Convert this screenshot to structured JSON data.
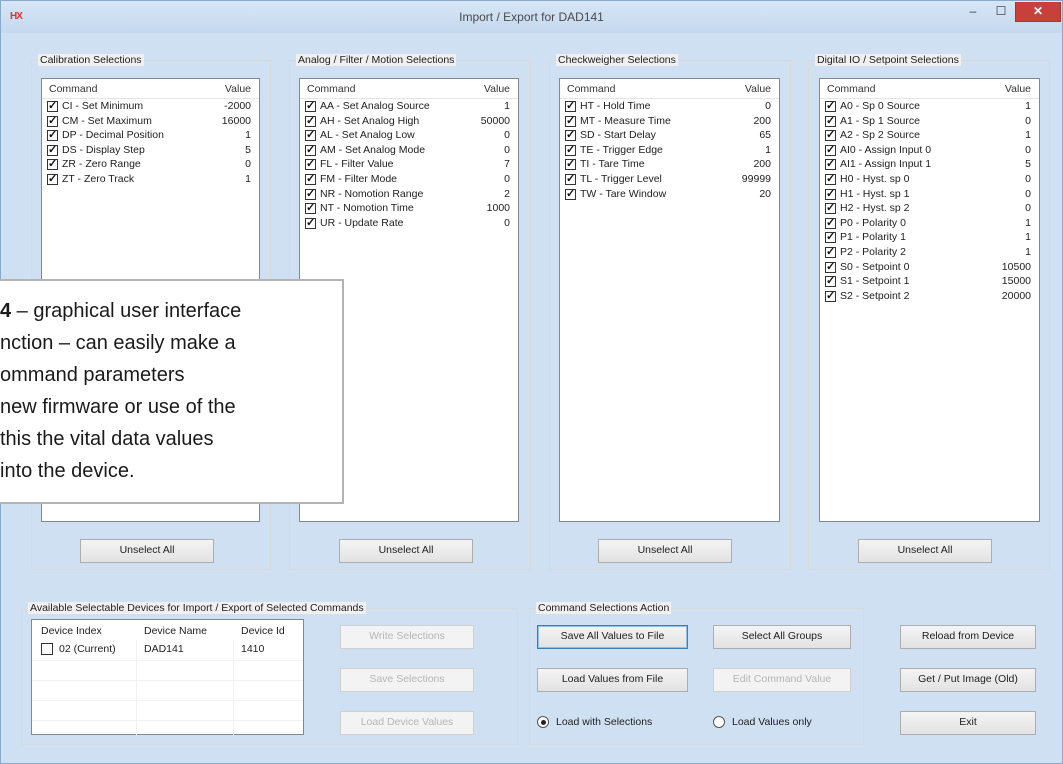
{
  "window": {
    "title": "Import / Export for DAD141",
    "app_icon_glyph": "HX",
    "minimize_glyph": "–",
    "maximize_glyph": "☐",
    "close_glyph": "✕"
  },
  "columns": {
    "command": "Command",
    "value": "Value"
  },
  "unselect_label": "Unselect All",
  "calibration": {
    "title": "Calibration Selections",
    "rows": [
      {
        "cmd": "CI - Set Minimum",
        "val": "-2000"
      },
      {
        "cmd": "CM - Set Maximum",
        "val": "16000"
      },
      {
        "cmd": "DP - Decimal Position",
        "val": "1"
      },
      {
        "cmd": "DS - Display Step",
        "val": "5"
      },
      {
        "cmd": "ZR - Zero Range",
        "val": "0"
      },
      {
        "cmd": "ZT - Zero Track",
        "val": "1"
      }
    ]
  },
  "analog": {
    "title": "Analog / Filter / Motion Selections",
    "rows": [
      {
        "cmd": "AA - Set Analog Source",
        "val": "1"
      },
      {
        "cmd": "AH - Set Analog High",
        "val": "50000"
      },
      {
        "cmd": "AL - Set Analog Low",
        "val": "0"
      },
      {
        "cmd": "AM - Set Analog Mode",
        "val": "0"
      },
      {
        "cmd": "FL - Filter Value",
        "val": "7"
      },
      {
        "cmd": "FM - Filter Mode",
        "val": "0"
      },
      {
        "cmd": "NR - Nomotion Range",
        "val": "2"
      },
      {
        "cmd": "NT - Nomotion Time",
        "val": "1000"
      },
      {
        "cmd": "UR - Update Rate",
        "val": "0"
      }
    ]
  },
  "checkweigher": {
    "title": "Checkweigher Selections",
    "rows": [
      {
        "cmd": "HT - Hold Time",
        "val": "0"
      },
      {
        "cmd": "MT - Measure Time",
        "val": "200"
      },
      {
        "cmd": "SD - Start Delay",
        "val": "65"
      },
      {
        "cmd": "TE - Trigger Edge",
        "val": "1"
      },
      {
        "cmd": "TI - Tare Time",
        "val": "200"
      },
      {
        "cmd": "TL - Trigger Level",
        "val": "99999"
      },
      {
        "cmd": "TW - Tare Window",
        "val": "20"
      }
    ]
  },
  "digital": {
    "title": "Digital IO / Setpoint Selections",
    "rows": [
      {
        "cmd": "A0 - Sp 0 Source",
        "val": "1"
      },
      {
        "cmd": "A1 - Sp 1 Source",
        "val": "0"
      },
      {
        "cmd": "A2 - Sp 2 Source",
        "val": "1"
      },
      {
        "cmd": "AI0 - Assign Input 0",
        "val": "0"
      },
      {
        "cmd": "AI1 - Assign Input 1",
        "val": "5"
      },
      {
        "cmd": "H0 - Hyst. sp 0",
        "val": "0"
      },
      {
        "cmd": "H1 - Hyst. sp 1",
        "val": "0"
      },
      {
        "cmd": "H2 - Hyst. sp 2",
        "val": "0"
      },
      {
        "cmd": "P0 - Polarity 0",
        "val": "1"
      },
      {
        "cmd": "P1 - Polarity 1",
        "val": "1"
      },
      {
        "cmd": "P2 - Polarity 2",
        "val": "1"
      },
      {
        "cmd": "S0 - Setpoint 0",
        "val": "10500"
      },
      {
        "cmd": "S1 - Setpoint 1",
        "val": "15000"
      },
      {
        "cmd": "S2 - Setpoint 2",
        "val": "20000"
      }
    ]
  },
  "devices": {
    "title": "Available Selectable Devices for Import / Export of Selected Commands",
    "col_index": "Device Index",
    "col_name": "Device Name",
    "col_id": "Device Id",
    "row": {
      "index": "02 (Current)",
      "name": "DAD141",
      "id": "1410"
    },
    "write_btn": "Write Selections",
    "save_btn": "Save Selections",
    "load_btn": "Load Device Values"
  },
  "actions": {
    "title": "Command Selections Action",
    "save_all": "Save All Values to File",
    "select_all": "Select All Groups",
    "load_file": "Load Values from File",
    "edit_value": "Edit Command Value",
    "radio_with": "Load with Selections",
    "radio_only": "Load Values only"
  },
  "right_buttons": {
    "reload": "Reload from Device",
    "image": "Get / Put Image (Old)",
    "exit": "Exit"
  },
  "overlay": {
    "line1_bold": "4",
    "line1_rest": " – graphical user interface",
    "line2": "nction – can easily make a",
    "line3": "ommand parameters",
    "line4": "new firmware or use of the",
    "line5": " this the vital data values",
    "line6": " into the device."
  }
}
